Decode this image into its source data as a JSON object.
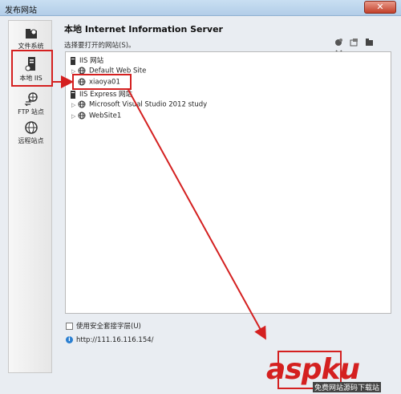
{
  "window": {
    "title": "发布网站",
    "close_glyph": "✕"
  },
  "sidebar": {
    "items": [
      {
        "label": "文件系统",
        "icon": "folder-icon"
      },
      {
        "label": "本地 IIS",
        "icon": "server-icon"
      },
      {
        "label": "FTP 站点",
        "icon": "ftp-icon"
      },
      {
        "label": "远程站点",
        "icon": "globe-icon"
      }
    ]
  },
  "main": {
    "title": "本地 Internet Information Server",
    "subtitle": "选择要打开的网站(S)。",
    "tree": [
      {
        "label": "IIS 网站",
        "icon": "server-icon",
        "level": 0,
        "expand": ""
      },
      {
        "label": "Default Web Site",
        "icon": "globe-icon",
        "level": 1,
        "expand": "▷"
      },
      {
        "label": "xiaoya01",
        "icon": "globe-icon",
        "level": 1,
        "expand": ""
      },
      {
        "label": "IIS Express 网站",
        "icon": "server-icon",
        "level": 0,
        "expand": ""
      },
      {
        "label": "Microsoft Visual Studio 2012 study",
        "icon": "globe-icon",
        "level": 1,
        "expand": "▷"
      },
      {
        "label": "WebSite1",
        "icon": "globe-icon",
        "level": 1,
        "expand": "▷"
      }
    ],
    "secure_label": "使用安全套接字层(U)",
    "url": "http://111.16.116.154/"
  },
  "watermark": {
    "text": "aspku",
    "sub": "免费网站源码下载站"
  },
  "colors": {
    "annotation": "#d42020",
    "titlebar": "#b2cde8",
    "accent": "#2a7fd1"
  }
}
